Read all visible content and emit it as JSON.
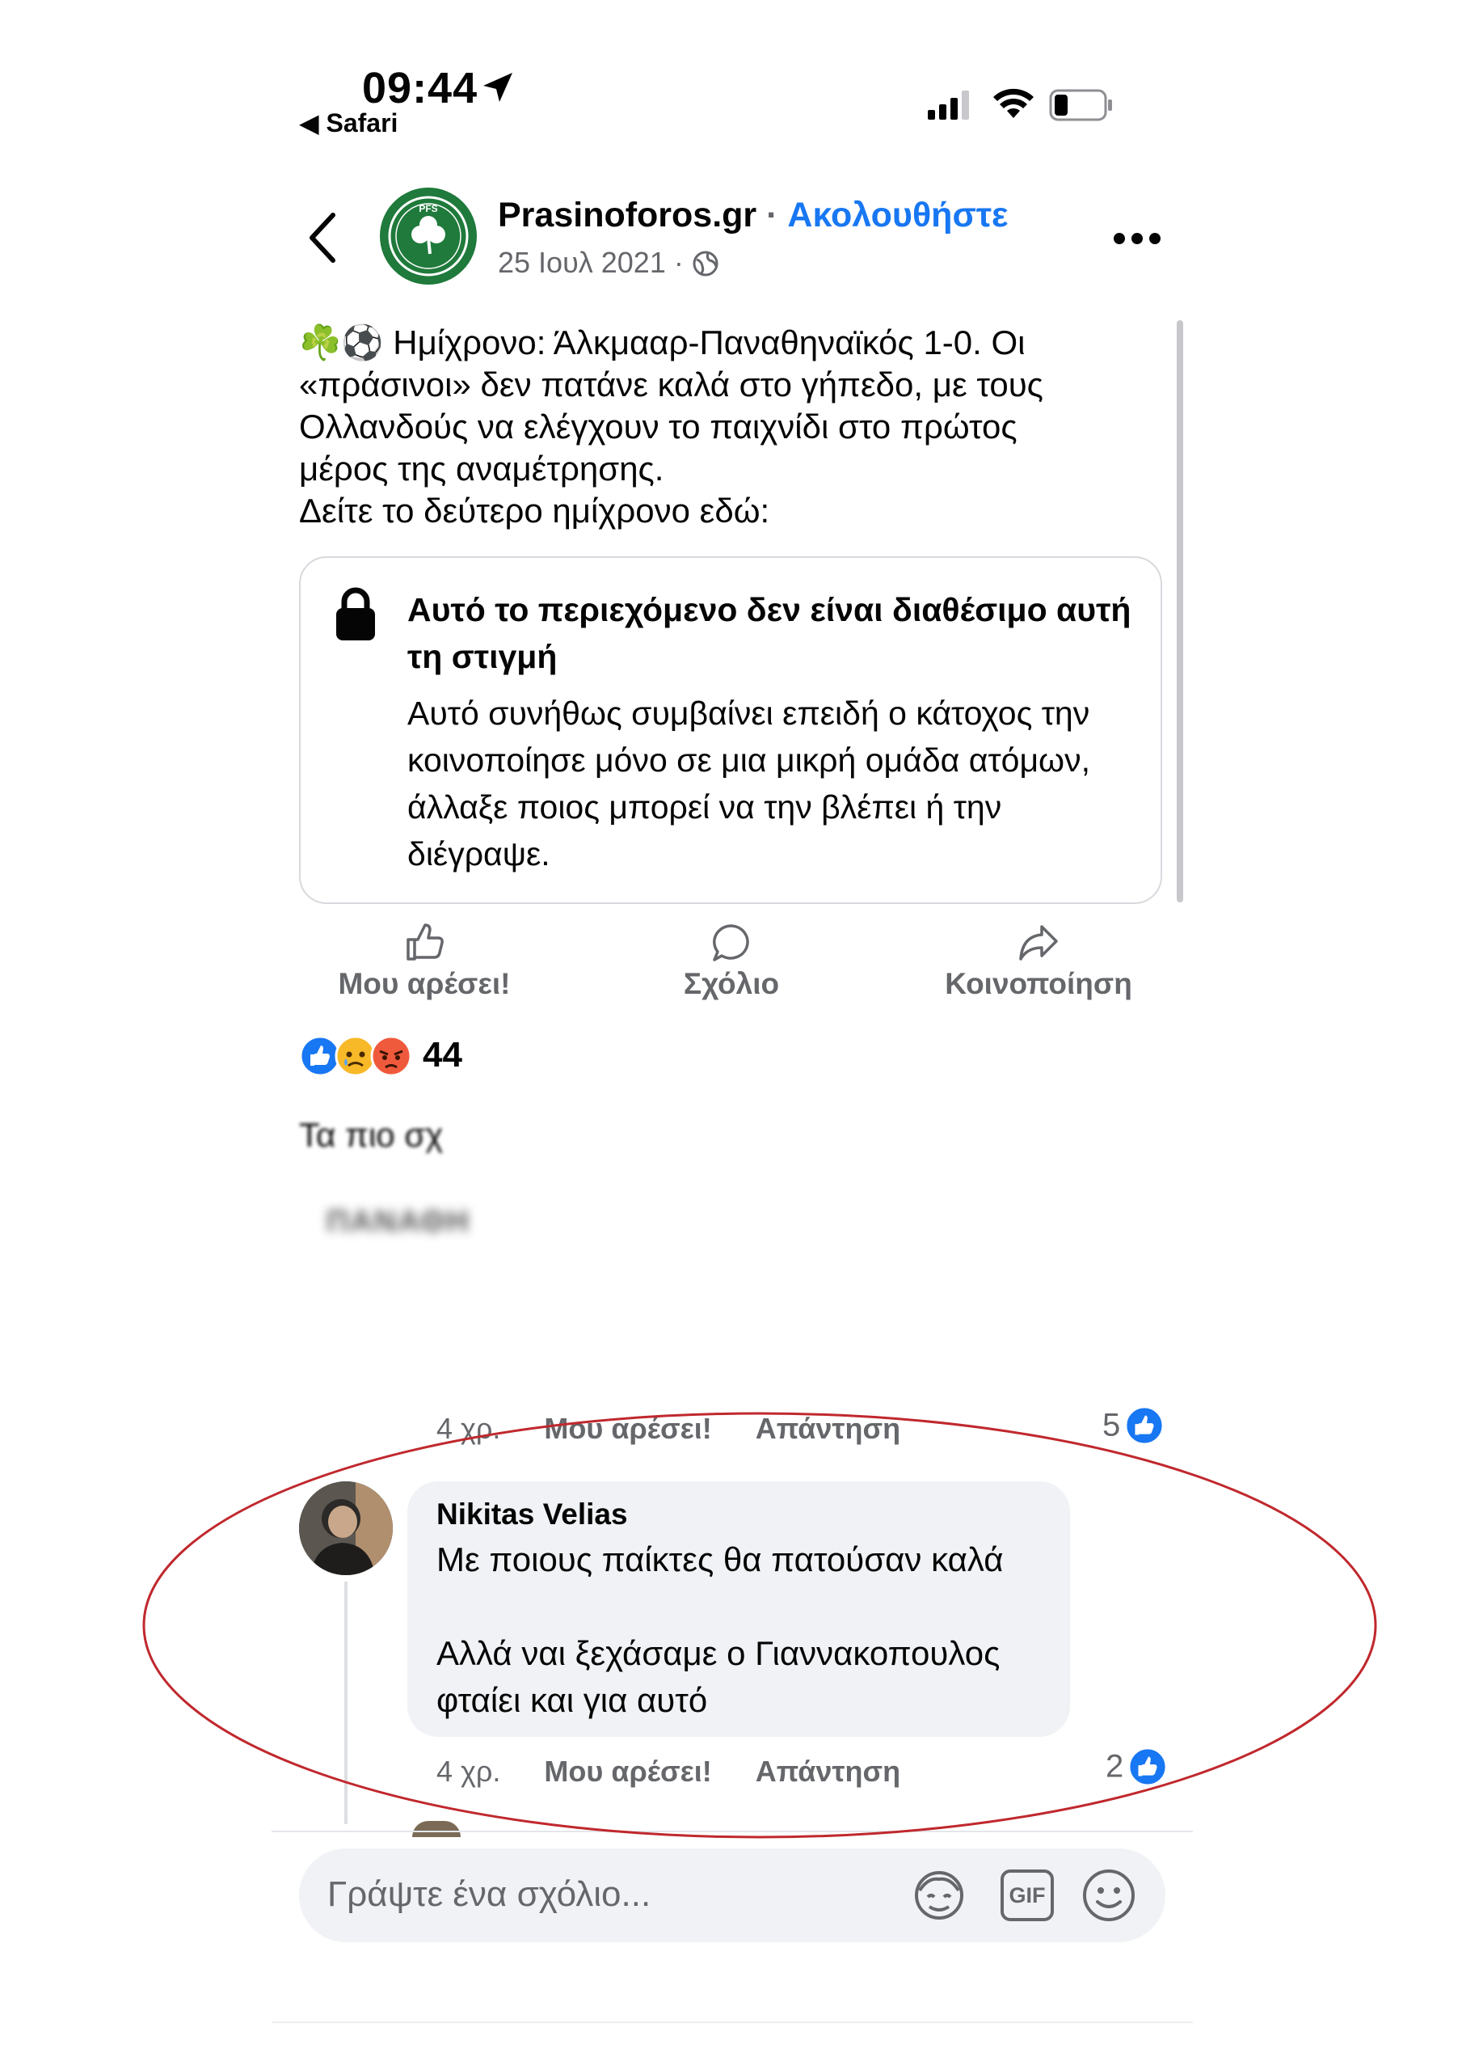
{
  "status_bar": {
    "time": "09:44",
    "back_app": "Safari"
  },
  "header": {
    "page_name": "Prasinoforos.gr",
    "separator": " · ",
    "follow_label": "Ακολουθήστε",
    "date": "25 Ιουλ 2021 ·",
    "avatar_text": "PFS",
    "back_icon": "chevron-left-icon",
    "more_icon": "more-options-icon"
  },
  "post": {
    "text": "☘️⚽️ Ημίχρονο: Άλκμααρ-Παναθηναϊκός 1-0. Οι\n«πράσινοι» δεν πατάνε καλά στο γήπεδο, με τους\nΟλλανδούς να ελέγχουν το παιχνίδι στο πρώτος\nμέρος της αναμέτρησης.\nΔείτε το δεύτερο ημίχρονο εδώ:"
  },
  "unavailable_card": {
    "title": "Αυτό το περιεχόμενο δεν είναι διαθέσιμο αυτή τη στιγμή",
    "body": "Αυτό συνήθως συμβαίνει επειδή ο κάτοχος την κοινοποίησε μόνο σε μια μικρή ομάδα ατόμων, άλλαξε ποιος μπορεί να την βλέπει ή την διέγραψε."
  },
  "actions": {
    "like": "Μου αρέσει!",
    "comment": "Σχόλιο",
    "share": "Κοινοποίηση"
  },
  "reactions": {
    "count": "44",
    "types": [
      "like",
      "sad",
      "angry"
    ]
  },
  "comments_section": {
    "sort_label": "Τα πιο σχ",
    "blurred_name": "ΠΑΝΑΘΗ"
  },
  "comment_prev": {
    "time": "4 χρ.",
    "like": "Μου αρέσει!",
    "reply": "Απάντηση",
    "like_count": "5"
  },
  "comment_main": {
    "author": "Nikitas Velias",
    "text": "Με ποιους παίκτες θα πατούσαν καλά\n\nΑλλά ναι ξεχάσαμε ο Γιαννακοπουλος\nφταίει και για αυτό",
    "time": "4 χρ.",
    "like": "Μου αρέσει!",
    "reply": "Απάντηση",
    "like_count": "2"
  },
  "composer": {
    "placeholder": "Γράψτε ένα σχόλιο...",
    "gif_label": "GIF"
  },
  "colors": {
    "accent": "#1877f2",
    "annotation": "#c0282d",
    "brand_green": "#1f7a3b"
  }
}
